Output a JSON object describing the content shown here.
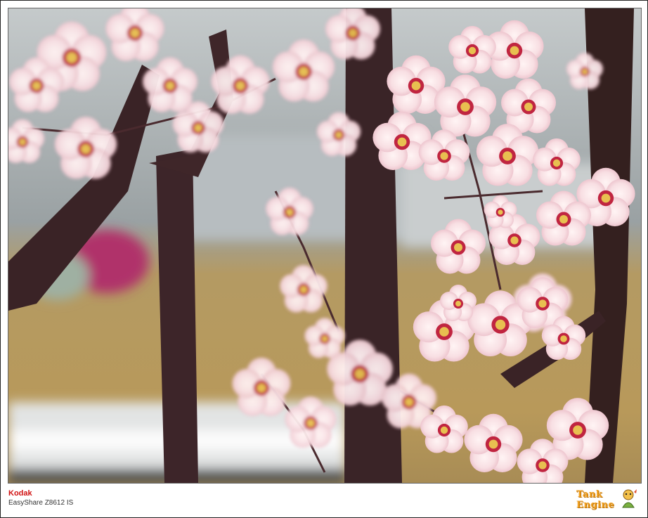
{
  "image": {
    "description_colors": {
      "sky": "#a9b2b4",
      "ground": "#b79a5a",
      "bark": "#3a2326",
      "blossom": "#f7dde1",
      "blossom_center": "#b81c3a"
    }
  },
  "camera_label": {
    "brand": "Kodak",
    "model": "EasyShare Z8612 IS"
  },
  "watermark": {
    "line1": "Tank",
    "line2": "Engine"
  }
}
